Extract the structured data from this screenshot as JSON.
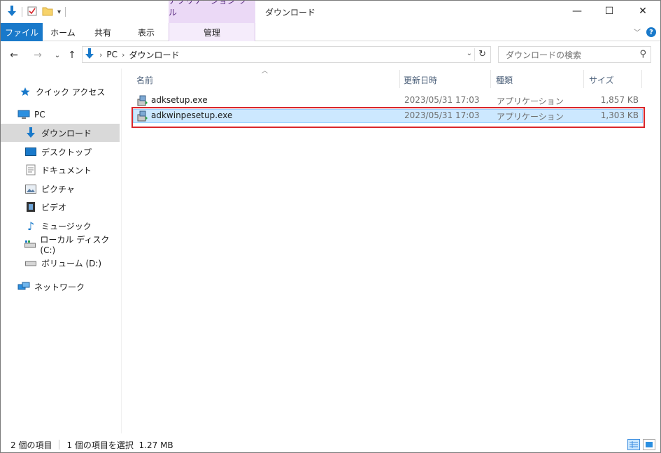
{
  "titlebar": {
    "context_tab_header": "アプリケーション ツール",
    "window_title": "ダウンロード",
    "minimize": "—",
    "maximize": "☐",
    "close": "✕"
  },
  "ribbon": {
    "tabs": [
      {
        "label": "ファイル"
      },
      {
        "label": "ホーム"
      },
      {
        "label": "共有"
      },
      {
        "label": "表示"
      },
      {
        "label": "管理"
      }
    ]
  },
  "address": {
    "crumbs": [
      "PC",
      "ダウンロード"
    ],
    "search_placeholder": "ダウンロードの検索"
  },
  "sidebar": {
    "items": [
      {
        "label": "クイック アクセス",
        "icon": "star-icon"
      },
      {
        "label": "PC",
        "icon": "computer-icon"
      },
      {
        "label": "ダウンロード",
        "icon": "download-icon"
      },
      {
        "label": "デスクトップ",
        "icon": "desktop-icon"
      },
      {
        "label": "ドキュメント",
        "icon": "document-icon"
      },
      {
        "label": "ピクチャ",
        "icon": "pictures-icon"
      },
      {
        "label": "ビデオ",
        "icon": "video-icon"
      },
      {
        "label": "ミュージック",
        "icon": "music-icon"
      },
      {
        "label": "ローカル ディスク (C:)",
        "icon": "drive-c-icon"
      },
      {
        "label": "ボリューム (D:)",
        "icon": "drive-d-icon"
      },
      {
        "label": "ネットワーク",
        "icon": "network-icon"
      }
    ]
  },
  "filelist": {
    "columns": [
      "名前",
      "更新日時",
      "種類",
      "サイズ"
    ],
    "rows": [
      {
        "name": "adksetup.exe",
        "date": "2023/05/31 17:03",
        "type": "アプリケーション",
        "size": "1,857 KB"
      },
      {
        "name": "adkwinpesetup.exe",
        "date": "2023/05/31 17:03",
        "type": "アプリケーション",
        "size": "1,303 KB"
      }
    ]
  },
  "status": {
    "item_count": "2 個の項目",
    "selection": "1 個の項目を選択  1.27 MB"
  },
  "colors": {
    "accent": "#1979ca",
    "selection_fill": "#cce8ff",
    "highlight_border": "#d9262b",
    "context_tab": "#ebd9f6"
  }
}
